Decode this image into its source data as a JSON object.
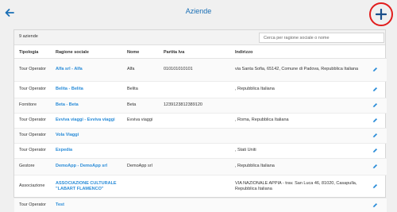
{
  "header": {
    "title": "Aziende"
  },
  "toolbar": {
    "count_label": "9 aziende",
    "search_placeholder": "Cerca per ragione sociale o nome"
  },
  "table": {
    "columns": [
      "Tipologia",
      "Ragione sociale",
      "Nome",
      "Partita Iva",
      "Indirizzo"
    ],
    "rows": [
      [
        "Tour Operator",
        "Alfa srl - Alfa",
        "Alfa",
        "010101010101",
        "via Santa Sofia, 65142, Comune di Padova, Repubblica Italiana"
      ],
      [
        "Tour Operator",
        "Belita - Belita",
        "Belita",
        "",
        ", Repubblica Italiana"
      ],
      [
        "Fornitore",
        "Beta - Beta",
        "Beta",
        "1239123812389120",
        ""
      ],
      [
        "Tour Operator",
        "Evviva viaggi - Evviva viaggi",
        "Evviva viaggi",
        "",
        ", Roma, Repubblica Italiana"
      ],
      [
        "Tour Operator",
        "Vola Viaggi",
        "",
        "",
        ""
      ],
      [
        "Tour Operator",
        "Expedia",
        "",
        "",
        ", Stati Uniti"
      ],
      [
        "Gestore",
        "DemoApp - DemoApp srl",
        "DemoApp srl",
        "",
        ", Repubblica Italiana"
      ],
      [
        "Associazione",
        "ASSOCIAZIONE CULTURALE \"LABART FLAMENCO\"",
        "",
        "",
        "VIA NAZIONALE APPIA - trav. San Luca 46, 81020, Casapulla, Repubblica Italiana"
      ],
      [
        "Tour Operator",
        "Test",
        "",
        "",
        ""
      ]
    ]
  },
  "icons": {
    "back": "back-arrow-icon",
    "add": "plus-icon",
    "edit": "pencil-icon"
  },
  "colors": {
    "accent": "#1a6fb5",
    "link": "#2a8cd8",
    "highlight": "#e11d1d"
  }
}
